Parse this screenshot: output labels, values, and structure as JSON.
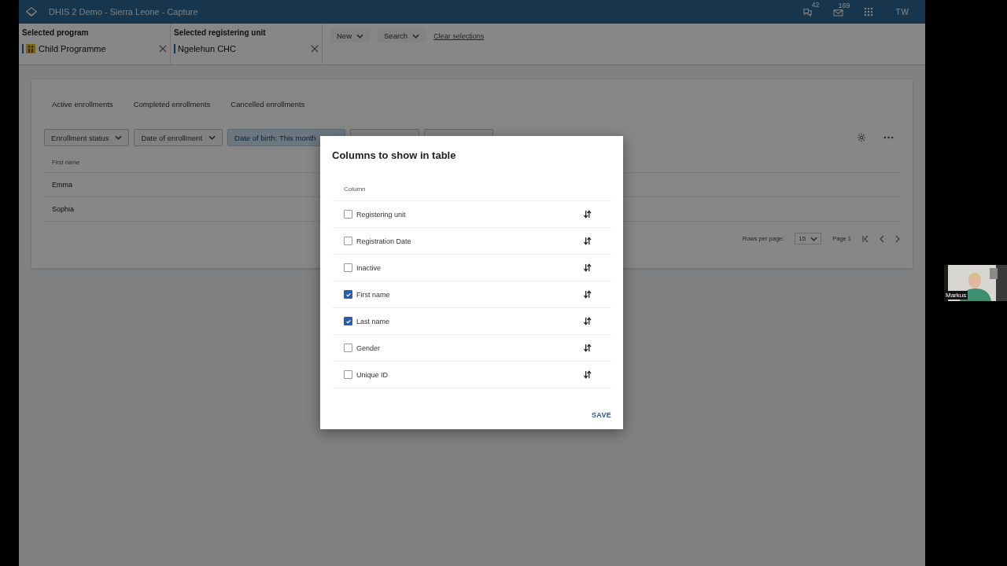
{
  "header": {
    "title": "DHIS 2 Demo - Sierra Leone - Capture",
    "interpretations_count": "42",
    "messages_count": "169",
    "user_initials": "TW"
  },
  "selectors": [
    {
      "label": "Selected program",
      "value": "Child Programme",
      "kind": "program"
    },
    {
      "label": "Selected registering unit",
      "value": "Ngelehun CHC",
      "kind": "orgunit"
    }
  ],
  "top_actions": {
    "new": "New",
    "search": "Search",
    "clear": "Clear selections"
  },
  "working_list_tabs": [
    {
      "label": "Active enrollments",
      "selected": false
    },
    {
      "label": "Completed enrollments",
      "selected": false
    },
    {
      "label": "Cancelled enrollments",
      "selected": false
    }
  ],
  "filters": [
    {
      "kind": "dropdown",
      "label": "Enrollment status",
      "active": false
    },
    {
      "kind": "dropdown",
      "label": "Date of enrollment",
      "active": false
    },
    {
      "kind": "dropdown",
      "label": "Date of birth: This month",
      "active": true
    },
    {
      "kind": "covered"
    },
    {
      "kind": "covered"
    }
  ],
  "table": {
    "columns": [
      "First name"
    ],
    "rows": [
      [
        "Emma"
      ],
      [
        "Sophia"
      ]
    ]
  },
  "pagination": {
    "rows_per_page_label": "Rows per page:",
    "rows_per_page": "15",
    "page": "Page 1"
  },
  "dialog": {
    "title": "Columns to show in table",
    "column_header": "Column",
    "save": "SAVE",
    "columns": [
      {
        "label": "Registering unit",
        "checked": false
      },
      {
        "label": "Registration Date",
        "checked": false
      },
      {
        "label": "Inactive",
        "checked": false
      },
      {
        "label": "First name",
        "checked": true
      },
      {
        "label": "Last name",
        "checked": true
      },
      {
        "label": "Gender",
        "checked": false
      },
      {
        "label": "Unique ID",
        "checked": false
      }
    ]
  },
  "video": {
    "kind": "picture",
    "name": "Markus"
  }
}
